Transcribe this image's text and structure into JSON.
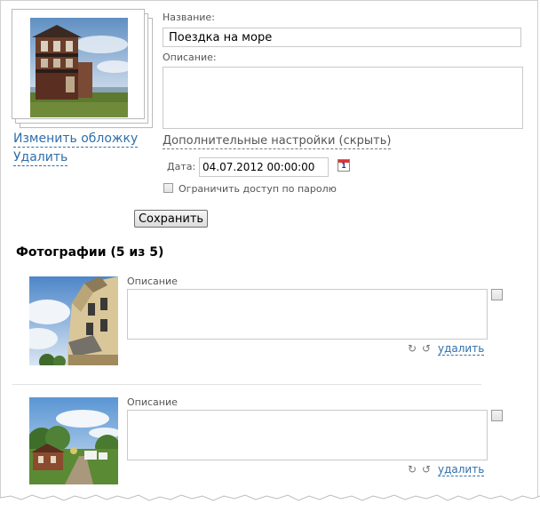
{
  "cover": {
    "change_label": "Изменить обложку",
    "delete_label": "Удалить"
  },
  "form": {
    "name_label": "Название:",
    "name_value": "Поездка на море",
    "description_label": "Описание:",
    "description_value": "",
    "advanced_link": "Дополнительные настройки (скрыть)",
    "date_label": "Дата:",
    "date_value": "04.07.2012 00:00:00",
    "calendar_day": "1",
    "password_label": "Ограничить доступ по паролю",
    "save_label": "Сохранить"
  },
  "photos": {
    "heading": "Фотографии (5 из 5)",
    "items": [
      {
        "description_label": "Описание",
        "description_value": "",
        "delete_label": "удалить",
        "rotate_left": "↻",
        "rotate_right": "↺"
      },
      {
        "description_label": "Описание",
        "description_value": "",
        "delete_label": "удалить",
        "rotate_left": "↻",
        "rotate_right": "↺"
      }
    ]
  },
  "colors": {
    "link": "#2f6fab",
    "calendar_red": "#dd3333"
  }
}
